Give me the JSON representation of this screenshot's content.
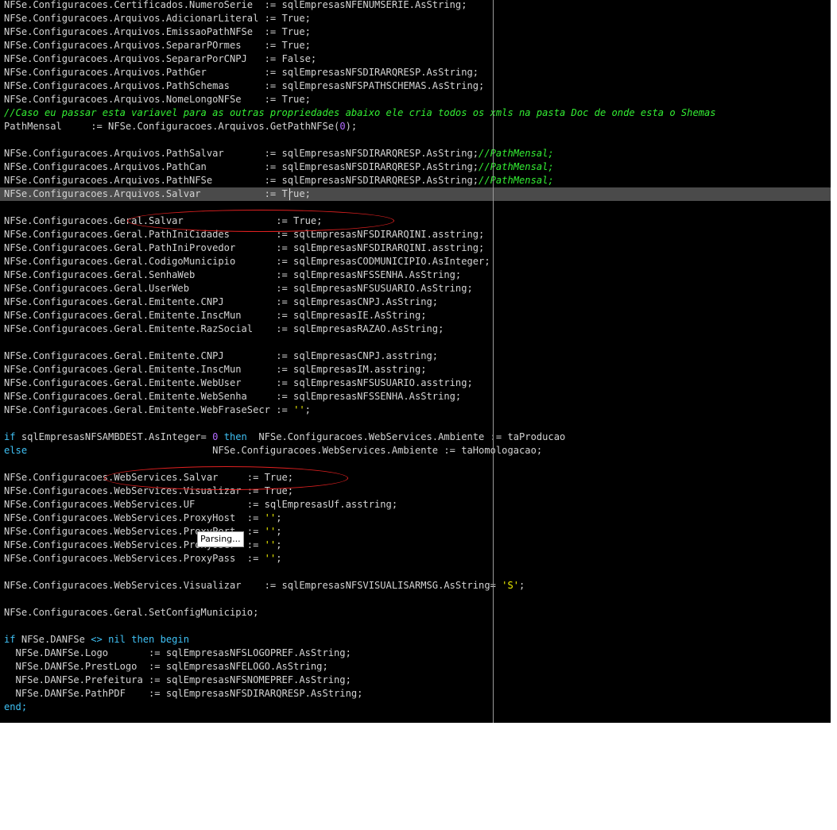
{
  "editor": {
    "lines": [
      [
        {
          "t": "NFSe.Configuracoes.Certificados.NumeroSerie  := sqlEmpresasNFENUMSERIE.AsString;",
          "c": ""
        }
      ],
      [
        {
          "t": "NFSe.Configuracoes.Arquivos.AdicionarLiteral := True;",
          "c": ""
        }
      ],
      [
        {
          "t": "NFSe.Configuracoes.Arquivos.EmissaoPathNFSe  := True;",
          "c": ""
        }
      ],
      [
        {
          "t": "NFSe.Configuracoes.Arquivos.SepararPOrmes    := True;",
          "c": ""
        }
      ],
      [
        {
          "t": "NFSe.Configuracoes.Arquivos.SepararPorCNPJ   := False;",
          "c": ""
        }
      ],
      [
        {
          "t": "NFSe.Configuracoes.Arquivos.PathGer          := sqlEmpresasNFSDIRARQRESP.AsString;",
          "c": ""
        }
      ],
      [
        {
          "t": "NFSe.Configuracoes.Arquivos.PathSchemas      := sqlEmpresasNFSPATHSCHEMAS.AsString;",
          "c": ""
        }
      ],
      [
        {
          "t": "NFSe.Configuracoes.Arquivos.NomeLongoNFSe    := True;",
          "c": ""
        }
      ],
      [
        {
          "t": "//Caso eu passar esta variavel para as outras propriedades abaixo ele cria todos os xmls na pasta Doc de onde esta o Shemas",
          "c": "cmt"
        }
      ],
      [
        {
          "t": "PathMensal     := NFSe.Configuracoes.Arquivos.GetPathNFSe(",
          "c": ""
        },
        {
          "t": "0",
          "c": "num"
        },
        {
          "t": ");",
          "c": ""
        }
      ],
      [
        {
          "t": "",
          "c": ""
        }
      ],
      [
        {
          "t": "NFSe.Configuracoes.Arquivos.PathSalvar       := sqlEmpresasNFSDIRARQRESP.AsString;",
          "c": ""
        },
        {
          "t": "//PathMensal;",
          "c": "cmt"
        }
      ],
      [
        {
          "t": "NFSe.Configuracoes.Arquivos.PathCan          := sqlEmpresasNFSDIRARQRESP.AsString;",
          "c": ""
        },
        {
          "t": "//PathMensal;",
          "c": "cmt"
        }
      ],
      [
        {
          "t": "NFSe.Configuracoes.Arquivos.PathNFSe         := sqlEmpresasNFSDIRARQRESP.AsString;",
          "c": ""
        },
        {
          "t": "//PathMensal;",
          "c": "cmt"
        }
      ],
      [
        {
          "t": "NFSe.Configuracoes.Arquivos.Salvar           := True;",
          "c": ""
        }
      ],
      [
        {
          "t": "",
          "c": ""
        }
      ],
      [
        {
          "t": "NFSe.Configuracoes.Geral.Salvar                := True;",
          "c": ""
        }
      ],
      [
        {
          "t": "NFSe.Configuracoes.Geral.PathIniCidades        := sqlEmpresasNFSDIRARQINI.asstring;",
          "c": ""
        }
      ],
      [
        {
          "t": "NFSe.Configuracoes.Geral.PathIniProvedor       := sqlEmpresasNFSDIRARQINI.asstring;",
          "c": ""
        }
      ],
      [
        {
          "t": "NFSe.Configuracoes.Geral.CodigoMunicipio       := sqlEmpresasCODMUNICIPIO.AsInteger;",
          "c": ""
        }
      ],
      [
        {
          "t": "NFSe.Configuracoes.Geral.SenhaWeb              := sqlEmpresasNFSSENHA.AsString;",
          "c": ""
        }
      ],
      [
        {
          "t": "NFSe.Configuracoes.Geral.UserWeb               := sqlEmpresasNFSUSUARIO.AsString;",
          "c": ""
        }
      ],
      [
        {
          "t": "NFSe.Configuracoes.Geral.Emitente.CNPJ         := sqlEmpresasCNPJ.AsString;",
          "c": ""
        }
      ],
      [
        {
          "t": "NFSe.Configuracoes.Geral.Emitente.InscMun      := sqlEmpresasIE.AsString;",
          "c": ""
        }
      ],
      [
        {
          "t": "NFSe.Configuracoes.Geral.Emitente.RazSocial    := sqlEmpresasRAZAO.AsString;",
          "c": ""
        }
      ],
      [
        {
          "t": "",
          "c": ""
        }
      ],
      [
        {
          "t": "NFSe.Configuracoes.Geral.Emitente.CNPJ         := sqlEmpresasCNPJ.asstring;",
          "c": ""
        }
      ],
      [
        {
          "t": "NFSe.Configuracoes.Geral.Emitente.InscMun      := sqlEmpresasIM.asstring;",
          "c": ""
        }
      ],
      [
        {
          "t": "NFSe.Configuracoes.Geral.Emitente.WebUser      := sqlEmpresasNFSUSUARIO.asstring;",
          "c": ""
        }
      ],
      [
        {
          "t": "NFSe.Configuracoes.Geral.Emitente.WebSenha     := sqlEmpresasNFSSENHA.AsString;",
          "c": ""
        }
      ],
      [
        {
          "t": "NFSe.Configuracoes.Geral.Emitente.WebFraseSecr := ",
          "c": ""
        },
        {
          "t": "''",
          "c": "str"
        },
        {
          "t": ";",
          "c": ""
        }
      ],
      [
        {
          "t": "",
          "c": ""
        }
      ],
      [
        {
          "t": "if",
          "c": "kw"
        },
        {
          "t": " sqlEmpresasNFSAMBDEST.AsInteger= ",
          "c": ""
        },
        {
          "t": "0",
          "c": "num"
        },
        {
          "t": " ",
          "c": ""
        },
        {
          "t": "then",
          "c": "kw"
        },
        {
          "t": "  NFSe.Configuracoes.WebServices.Ambiente := taProducao",
          "c": ""
        }
      ],
      [
        {
          "t": "else",
          "c": "kw"
        },
        {
          "t": "                                NFSe.Configuracoes.WebServices.Ambiente := taHomologacao;",
          "c": ""
        }
      ],
      [
        {
          "t": "",
          "c": ""
        }
      ],
      [
        {
          "t": "NFSe.Configuracoes.WebServices.Salvar     := True;",
          "c": ""
        }
      ],
      [
        {
          "t": "NFSe.Configuracoes.WebServices.Visualizar := True;",
          "c": ""
        }
      ],
      [
        {
          "t": "NFSe.Configuracoes.WebServices.UF         := sqlEmpresasUf.asstring;",
          "c": ""
        }
      ],
      [
        {
          "t": "NFSe.Configuracoes.WebServices.ProxyHost  := ",
          "c": ""
        },
        {
          "t": "''",
          "c": "str"
        },
        {
          "t": ";",
          "c": ""
        }
      ],
      [
        {
          "t": "NFSe.Configuracoes.WebServices.ProxyPort  := ",
          "c": ""
        },
        {
          "t": "''",
          "c": "str"
        },
        {
          "t": ";",
          "c": ""
        }
      ],
      [
        {
          "t": "NFSe.Configuracoes.WebServices.ProxyUser  := ",
          "c": ""
        },
        {
          "t": "''",
          "c": "str"
        },
        {
          "t": ";",
          "c": ""
        }
      ],
      [
        {
          "t": "NFSe.Configuracoes.WebServices.ProxyPass  := ",
          "c": ""
        },
        {
          "t": "''",
          "c": "str"
        },
        {
          "t": ";",
          "c": ""
        }
      ],
      [
        {
          "t": "",
          "c": ""
        }
      ],
      [
        {
          "t": "NFSe.Configuracoes.WebServices.Visualizar    := sqlEmpresasNFSVISUALISARMSG.AsString= ",
          "c": ""
        },
        {
          "t": "'S'",
          "c": "str"
        },
        {
          "t": ";",
          "c": ""
        }
      ],
      [
        {
          "t": "",
          "c": ""
        }
      ],
      [
        {
          "t": "NFSe.Configuracoes.Geral.SetConfigMunicipio;",
          "c": ""
        }
      ],
      [
        {
          "t": "",
          "c": ""
        }
      ],
      [
        {
          "t": "if",
          "c": "kw"
        },
        {
          "t": " NFSe.DANFSe ",
          "c": ""
        },
        {
          "t": "<>",
          "c": "kw"
        },
        {
          "t": " ",
          "c": ""
        },
        {
          "t": "nil",
          "c": "kw"
        },
        {
          "t": " ",
          "c": ""
        },
        {
          "t": "then begin",
          "c": "kw"
        }
      ],
      [
        {
          "t": "  NFSe.DANFSe.Logo       := sqlEmpresasNFSLOGOPREF.AsString;",
          "c": ""
        }
      ],
      [
        {
          "t": "  NFSe.DANFSe.PrestLogo  := sqlEmpresasNFELOGO.AsString;",
          "c": ""
        }
      ],
      [
        {
          "t": "  NFSe.DANFSe.Prefeitura := sqlEmpresasNFSNOMEPREF.AsString;",
          "c": ""
        }
      ],
      [
        {
          "t": "  NFSe.DANFSe.PathPDF    := sqlEmpresasNFSDIRARQRESP.AsString;",
          "c": ""
        }
      ],
      [
        {
          "t": "end;",
          "c": "kw"
        }
      ]
    ],
    "highlighted_line": 15
  },
  "tooltip": {
    "text": "Parsing..."
  },
  "colors": {
    "background": "#000000",
    "text": "#d4d4d4",
    "keyword": "#3fc1f5",
    "number": "#b36bff",
    "string": "#f0f000",
    "comment": "#33ee33",
    "current_line": "#4a4a4a",
    "annotation": "#e02020"
  }
}
